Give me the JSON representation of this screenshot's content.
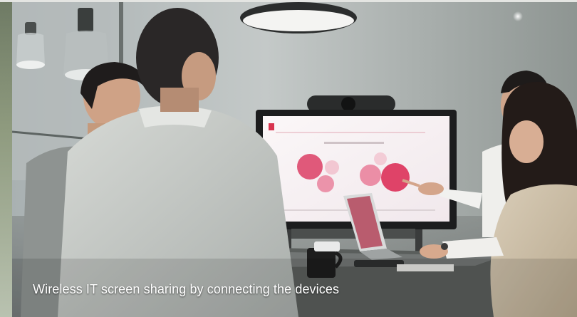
{
  "video": {
    "caption": "Wireless IT screen sharing by connecting the devices",
    "scene": "meeting-room-screen-sharing"
  }
}
